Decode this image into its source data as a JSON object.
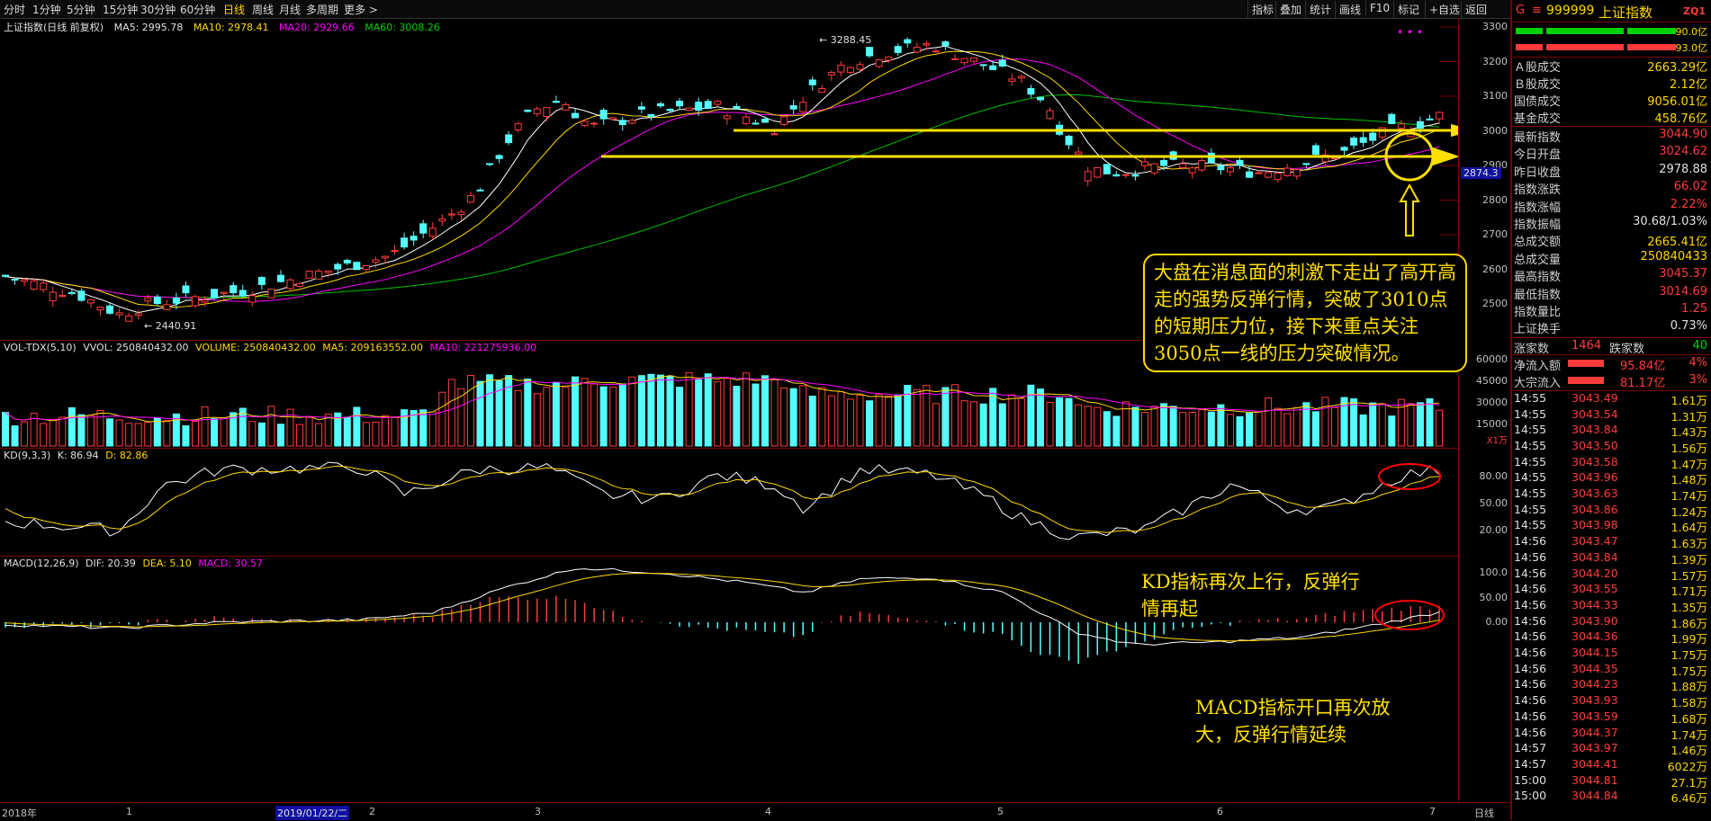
{
  "toolbar": {
    "periods": [
      "分时",
      "1分钟",
      "5分钟",
      "15分钟",
      "30分钟",
      "60分钟",
      "日线",
      "周线",
      "月线",
      "多周期",
      "更多 >"
    ],
    "active": "日线",
    "right_buttons": [
      "指标",
      "叠加",
      "统计",
      "画线",
      "F10",
      "标记",
      "+自选",
      "返回"
    ]
  },
  "chart_header": {
    "name": "上证指数(日线 前复权)",
    "ma5": "MA5: 2995.78",
    "ma10": "MA10: 2978.41",
    "ma20": "MA20: 2929.66",
    "ma60": "MA60: 3008.26",
    "high_label": "3288.45",
    "low_label": "2440.91",
    "current_price_tag": "2874.3"
  },
  "vol_header": {
    "name": "VOL-TDX(5,10)",
    "vvol": "VVOL: 250840432.00",
    "volume": "VOLUME: 250840432.00",
    "ma5": "MA5: 209163552.00",
    "ma10": "MA10: 221275936.00",
    "unit": "X1万"
  },
  "kd_header": {
    "name": "KD(9,3,3)",
    "k": "K: 86.94",
    "d": "D: 82.86"
  },
  "macd_header": {
    "name": "MACD(12,26,9)",
    "dif": "DIF: 20.39",
    "dea": "DEA: 5.10",
    "macd": "MACD: 30.57"
  },
  "price_axis": [
    "3300",
    "3200",
    "3100",
    "3000",
    "2900",
    "2800",
    "2700",
    "2600",
    "2500"
  ],
  "vol_axis": [
    "60000",
    "45000",
    "30000",
    "15000"
  ],
  "kd_axis": [
    "80.00",
    "50.00",
    "20.00"
  ],
  "macd_axis": [
    "100.0",
    "50.00",
    "0.00"
  ],
  "x_axis": {
    "labels": [
      "2018年",
      "1",
      "2019/01/22/二",
      "2",
      "3",
      "4",
      "5",
      "6",
      "7"
    ],
    "right": "日线"
  },
  "annotations": {
    "main": "大盘在消息面的刺激下走出了高开高走的强势反弹行情，突破了3010点的短期压力位，接下来重点关注3050点一线的压力突破情况。",
    "kd": "KD指标再次上行，反弹行情再起",
    "macd": "MACD指标开口再次放大，反弹行情延续"
  },
  "sidebar": {
    "code": "999999",
    "name": "上证指数",
    "tag": "ZQ1",
    "marker": "G",
    "bar1": "90.0亿",
    "bar2": "93.0亿",
    "stats1": [
      {
        "label": "Ａ股成交",
        "value": "2663.29亿",
        "color": "#ffd700"
      },
      {
        "label": "Ｂ股成交",
        "value": "2.12亿",
        "color": "#ffd700"
      },
      {
        "label": "国债成交",
        "value": "9056.01亿",
        "color": "#ffd700"
      },
      {
        "label": "基金成交",
        "value": "458.76亿",
        "color": "#ffd700"
      }
    ],
    "stats2": [
      {
        "label": "最新指数",
        "value": "3044.90",
        "color": "#ff3b3b"
      },
      {
        "label": "今日开盘",
        "value": "3024.62",
        "color": "#ff3b3b"
      },
      {
        "label": "昨日收盘",
        "value": "2978.88",
        "color": "#e0e0e0"
      },
      {
        "label": "指数涨跌",
        "value": "66.02",
        "color": "#ff3b3b"
      },
      {
        "label": "指数涨幅",
        "value": "2.22%",
        "color": "#ff3b3b"
      },
      {
        "label": "指数振幅",
        "value": "30.68/1.03%",
        "color": "#e0e0e0"
      },
      {
        "label": "总成交额",
        "value": "2665.41亿",
        "color": "#ffd700"
      },
      {
        "label": "总成交量",
        "value": "250840433",
        "color": "#ffd700"
      },
      {
        "label": "最高指数",
        "value": "3045.37",
        "color": "#ff3b3b"
      },
      {
        "label": "最低指数",
        "value": "3014.69",
        "color": "#ff3b3b"
      },
      {
        "label": "指数量比",
        "value": "1.25",
        "color": "#ff3b3b"
      },
      {
        "label": "上证换手",
        "value": "0.73%",
        "color": "#e0e0e0"
      }
    ],
    "up_label": "涨家数",
    "up": "1464",
    "down_label": "跌家数",
    "down": "40",
    "inflow_label": "净流入额",
    "inflow": "95.84亿",
    "inflow_pct": "4%",
    "block_label": "大宗流入",
    "block": "81.17亿",
    "block_pct": "3%",
    "ticks": [
      [
        "14:55",
        "3043.49",
        "1.61万"
      ],
      [
        "14:55",
        "3043.54",
        "1.31万"
      ],
      [
        "14:55",
        "3043.84",
        "1.43万"
      ],
      [
        "14:55",
        "3043.50",
        "1.56万"
      ],
      [
        "14:55",
        "3043.58",
        "1.47万"
      ],
      [
        "14:55",
        "3043.96",
        "1.48万"
      ],
      [
        "14:55",
        "3043.63",
        "1.74万"
      ],
      [
        "14:55",
        "3043.86",
        "1.24万"
      ],
      [
        "14:55",
        "3043.98",
        "1.64万"
      ],
      [
        "14:56",
        "3043.47",
        "1.63万"
      ],
      [
        "14:56",
        "3043.84",
        "1.39万"
      ],
      [
        "14:56",
        "3044.20",
        "1.57万"
      ],
      [
        "14:56",
        "3043.55",
        "1.71万"
      ],
      [
        "14:56",
        "3044.33",
        "1.35万"
      ],
      [
        "14:56",
        "3043.90",
        "1.86万"
      ],
      [
        "14:56",
        "3044.36",
        "1.99万"
      ],
      [
        "14:56",
        "3044.15",
        "1.75万"
      ],
      [
        "14:56",
        "3044.35",
        "1.75万"
      ],
      [
        "14:56",
        "3044.23",
        "1.88万"
      ],
      [
        "14:56",
        "3043.93",
        "1.58万"
      ],
      [
        "14:56",
        "3043.59",
        "1.68万"
      ],
      [
        "14:56",
        "3044.37",
        "1.74万"
      ],
      [
        "14:57",
        "3043.97",
        "1.46万"
      ],
      [
        "14:57",
        "3044.41",
        "6022万"
      ],
      [
        "15:00",
        "3044.81",
        "27.1万"
      ],
      [
        "15:00",
        "3044.84",
        "6.46万"
      ]
    ]
  },
  "colors": {
    "up": "#ff3b3b",
    "down": "#54ffff",
    "ma5": "#ffffff",
    "ma10": "#ffd700",
    "ma20": "#ff00ff",
    "ma60": "#00c000"
  }
}
